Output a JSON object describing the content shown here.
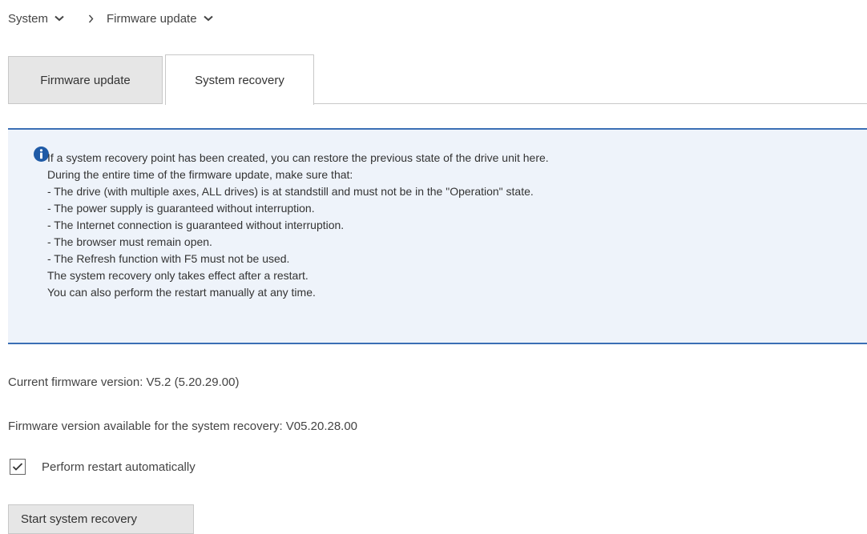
{
  "breadcrumb": {
    "items": [
      {
        "label": "System"
      },
      {
        "label": "Firmware update"
      }
    ]
  },
  "tabs": [
    {
      "label": "Firmware update",
      "active": false
    },
    {
      "label": "System recovery",
      "active": true
    }
  ],
  "info": {
    "icon": "info-icon",
    "lines": [
      "If a system recovery point has been created, you can restore the previous state of the drive unit here.",
      "During the entire time of the firmware update, make sure that:",
      "- The drive (with multiple axes, ALL drives) is at standstill and must not be in the \"Operation\" state.",
      "- The power supply is guaranteed without interruption.",
      "- The Internet connection is guaranteed without interruption.",
      "- The browser must remain open.",
      "- The Refresh function with F5 must not be used.",
      "The system recovery only takes effect after a restart.",
      "You can also perform the restart manually at any time."
    ]
  },
  "current_version": "Current firmware version: V5.2 (5.20.29.00)",
  "recovery_version": "Firmware version available for the system recovery: V05.20.28.00",
  "auto_restart": {
    "label": "Perform restart automatically",
    "checked": true
  },
  "start_button": "Start system recovery",
  "colors": {
    "accent": "#3b6fb5",
    "info_bg": "#eef3fa",
    "tab_inactive_bg": "#e6e6e6"
  }
}
